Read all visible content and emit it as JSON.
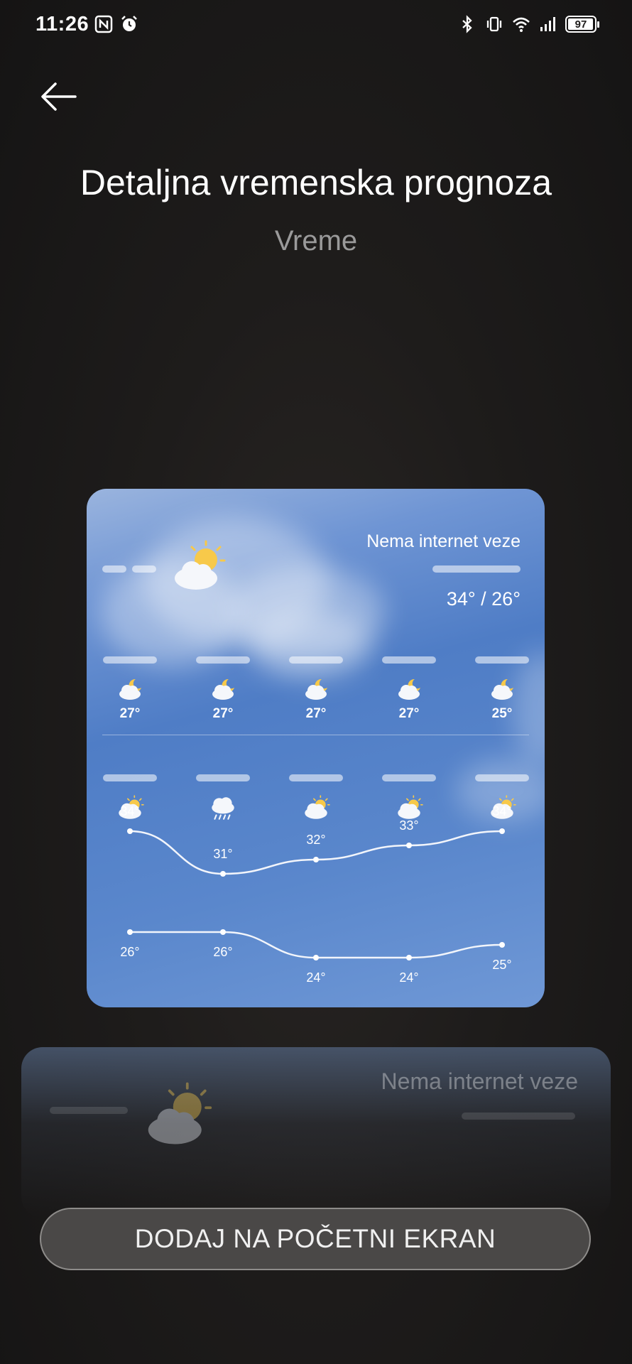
{
  "status_bar": {
    "time": "11:26",
    "left_icons": [
      "nfc-icon",
      "alarm-icon"
    ],
    "right_icons": [
      "bluetooth-icon",
      "vibrate-icon",
      "wifi-icon",
      "signal-icon",
      "battery-icon"
    ],
    "battery_level": "97"
  },
  "header": {
    "back_icon": "back-arrow-icon",
    "title": "Detaljna vremenska prognoza",
    "subtitle": "Vreme"
  },
  "widget": {
    "status_text": "Nema internet veze",
    "current_icon": "partly-sunny-icon",
    "temp_range": "34° / 26°",
    "hourly": [
      {
        "icon": "partly-cloudy-night-icon",
        "temp": "27°"
      },
      {
        "icon": "partly-cloudy-night-icon",
        "temp": "27°"
      },
      {
        "icon": "partly-cloudy-night-icon",
        "temp": "27°"
      },
      {
        "icon": "partly-cloudy-night-icon",
        "temp": "27°"
      },
      {
        "icon": "partly-cloudy-night-icon",
        "temp": "25°"
      }
    ],
    "daily": [
      {
        "icon": "partly-sunny-icon",
        "high": "34°",
        "low": "26°"
      },
      {
        "icon": "rain-icon",
        "high": "31°",
        "low": "26°"
      },
      {
        "icon": "partly-sunny-icon",
        "high": "32°",
        "low": "24°"
      },
      {
        "icon": "partly-sunny-icon",
        "high": "33°",
        "low": "24°"
      },
      {
        "icon": "partly-sunny-icon",
        "high": "34°",
        "low": "25°"
      }
    ]
  },
  "ghost_card": {
    "status_text": "Nema internet veze"
  },
  "add_button": {
    "label": "DODAJ NA POČETNI EKRAN"
  }
}
